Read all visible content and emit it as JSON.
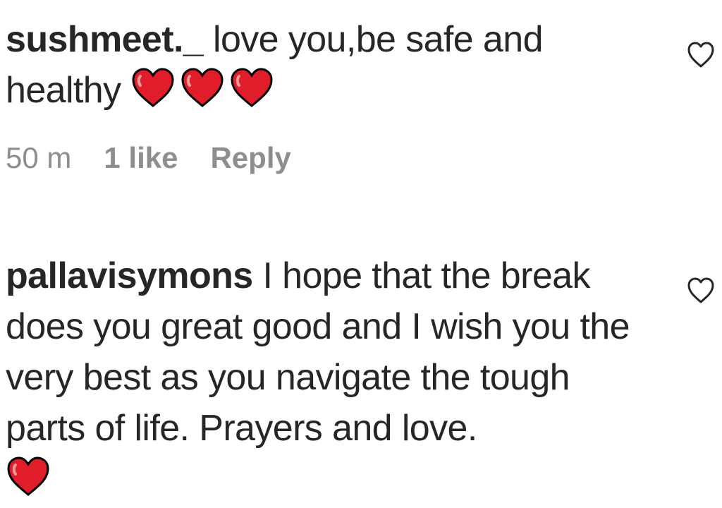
{
  "comments": [
    {
      "username": "sushmeet._",
      "text": " love you,be safe and healthy ",
      "emoji": [
        "red-heart",
        "red-heart",
        "red-heart"
      ],
      "time": "50 m",
      "likes": "1 like",
      "reply_label": "Reply"
    },
    {
      "username": "pallavisymons",
      "text": " I hope that the break does you great good and I wish you the very best as you navigate the tough parts of life. Prayers and love.",
      "emoji": [
        "red-heart"
      ]
    }
  ],
  "icons": {
    "like": "heart-outline-icon",
    "emoji": "red-heart-emoji"
  },
  "colors": {
    "text": "#262626",
    "meta": "#8e8e8e",
    "heart": "#e11d2b"
  }
}
